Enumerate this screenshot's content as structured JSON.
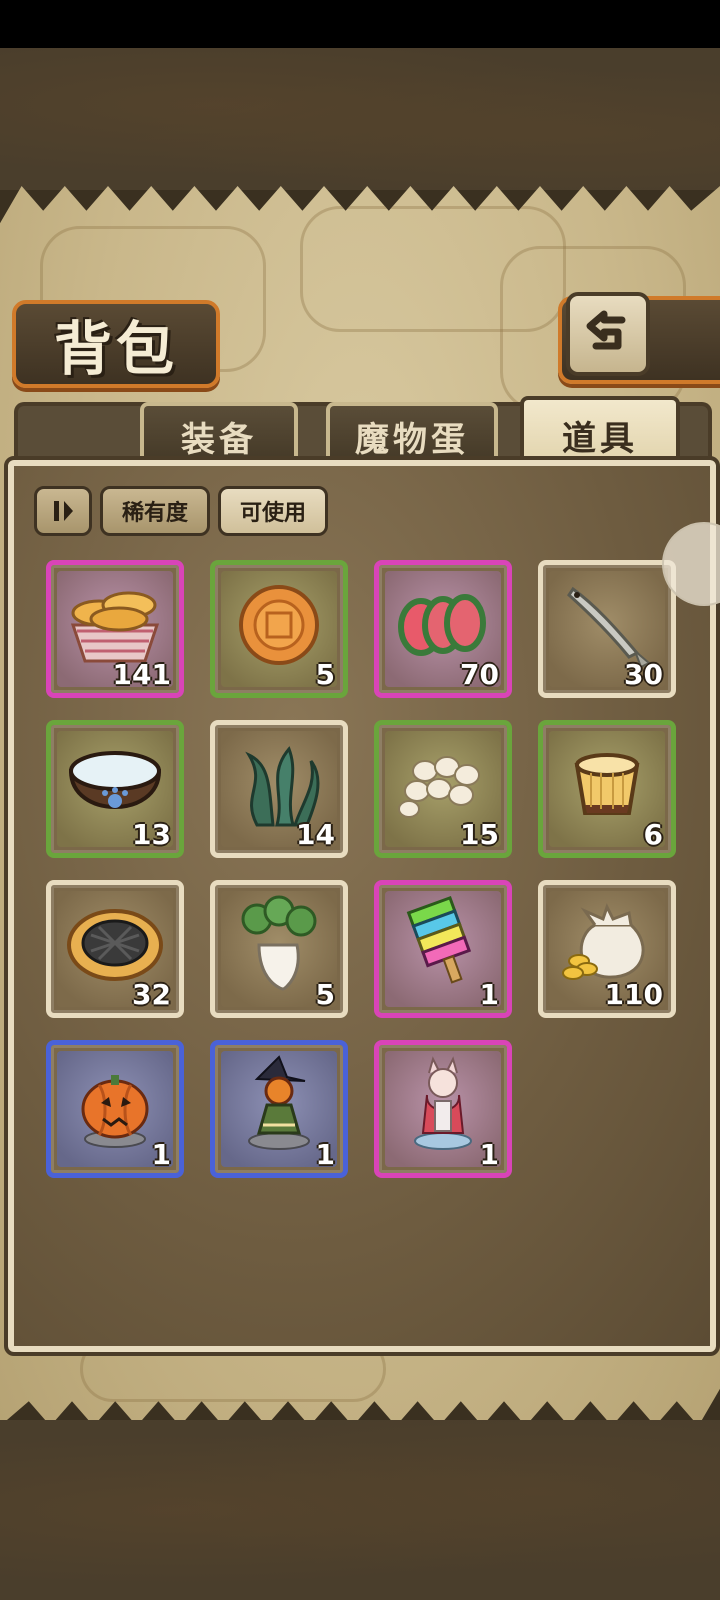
{
  "screen": {
    "title": "背包"
  },
  "tabs": [
    {
      "label": "装备",
      "active": false
    },
    {
      "label": "魔物蛋",
      "active": false
    },
    {
      "label": "道具",
      "active": true
    }
  ],
  "filters": {
    "sort_icon": "sort-toggle-icon",
    "rarity_label": "稀有度",
    "usable_label": "可使用"
  },
  "items": [
    {
      "name": "bread-basket",
      "icon": "bread-basket-icon",
      "rarity": "pink",
      "qty": "141"
    },
    {
      "name": "mooncake",
      "icon": "mooncake-icon",
      "rarity": "green",
      "qty": "5"
    },
    {
      "name": "meat-slices",
      "icon": "meat-slices-icon",
      "rarity": "pink",
      "qty": "70"
    },
    {
      "name": "small-fish",
      "icon": "fish-icon",
      "rarity": "tan",
      "qty": "30"
    },
    {
      "name": "water-bowl",
      "icon": "water-bowl-icon",
      "rarity": "green",
      "qty": "13"
    },
    {
      "name": "seaweed",
      "icon": "seaweed-icon",
      "rarity": "tan",
      "qty": "14"
    },
    {
      "name": "rice-balls",
      "icon": "rice-balls-icon",
      "rarity": "green",
      "qty": "15"
    },
    {
      "name": "pudding",
      "icon": "pudding-icon",
      "rarity": "green",
      "qty": "6"
    },
    {
      "name": "waffle-cookie",
      "icon": "waffle-cookie-icon",
      "rarity": "tan",
      "qty": "32"
    },
    {
      "name": "radish",
      "icon": "radish-icon",
      "rarity": "tan",
      "qty": "5"
    },
    {
      "name": "rainbow-popsicle",
      "icon": "popsicle-icon",
      "rarity": "pink",
      "qty": "1"
    },
    {
      "name": "coin-sack",
      "icon": "coin-sack-icon",
      "rarity": "tan",
      "qty": "110"
    },
    {
      "name": "pumpkin-figure",
      "icon": "pumpkin-figure-icon",
      "rarity": "blue",
      "qty": "1"
    },
    {
      "name": "witch-figure",
      "icon": "witch-figure-icon",
      "rarity": "blue",
      "qty": "1"
    },
    {
      "name": "fox-girl-figure",
      "icon": "fox-girl-figure-icon",
      "rarity": "pink",
      "qty": "1"
    }
  ],
  "colors": {
    "pink": "#d944b8",
    "green": "#6aa53c",
    "tan": "#e8dcc0",
    "blue": "#4a62d8",
    "accent_orange": "#d07a2a"
  }
}
